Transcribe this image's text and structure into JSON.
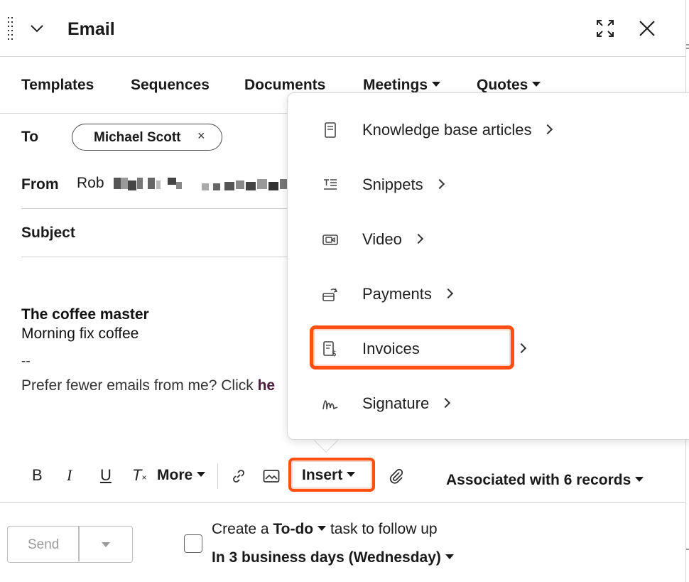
{
  "header": {
    "title": "Email"
  },
  "tabs": [
    {
      "label": "Templates"
    },
    {
      "label": "Sequences"
    },
    {
      "label": "Documents"
    },
    {
      "label": "Meetings"
    },
    {
      "label": "Quotes"
    }
  ],
  "fields": {
    "to_label": "To",
    "to_recipient": "Michael Scott",
    "chip_remove": "×",
    "from_label": "From",
    "from_name": "Rob",
    "subject_label": "Subject"
  },
  "body": {
    "signature_title": "The coffee master",
    "signature_line": "Morning fix coffee",
    "separator": "--",
    "unsubscribe_text": "Prefer fewer emails from me? Click ",
    "unsubscribe_link": "he"
  },
  "toolbar": {
    "bold": "B",
    "italic": "I",
    "underline": "U",
    "clear_format": "T",
    "more_label": "More",
    "insert_label": "Insert",
    "associated_label": "Associated with 6 records"
  },
  "insert_menu": {
    "items": [
      {
        "label": "Knowledge base articles",
        "icon": "document-icon"
      },
      {
        "label": "Snippets",
        "icon": "snippet-icon"
      },
      {
        "label": "Video",
        "icon": "video-icon"
      },
      {
        "label": "Payments",
        "icon": "payments-icon"
      },
      {
        "label": "Invoices",
        "icon": "invoice-icon",
        "highlighted": true
      },
      {
        "label": "Signature",
        "icon": "signature-icon"
      }
    ]
  },
  "footer": {
    "send_label": "Send",
    "task_prefix": "Create a ",
    "task_type": "To-do",
    "task_suffix": " task to follow up",
    "due_label": "In 3 business days (Wednesday)"
  },
  "colors": {
    "highlight": "#ff4f12",
    "link": "#4b1e3a"
  }
}
